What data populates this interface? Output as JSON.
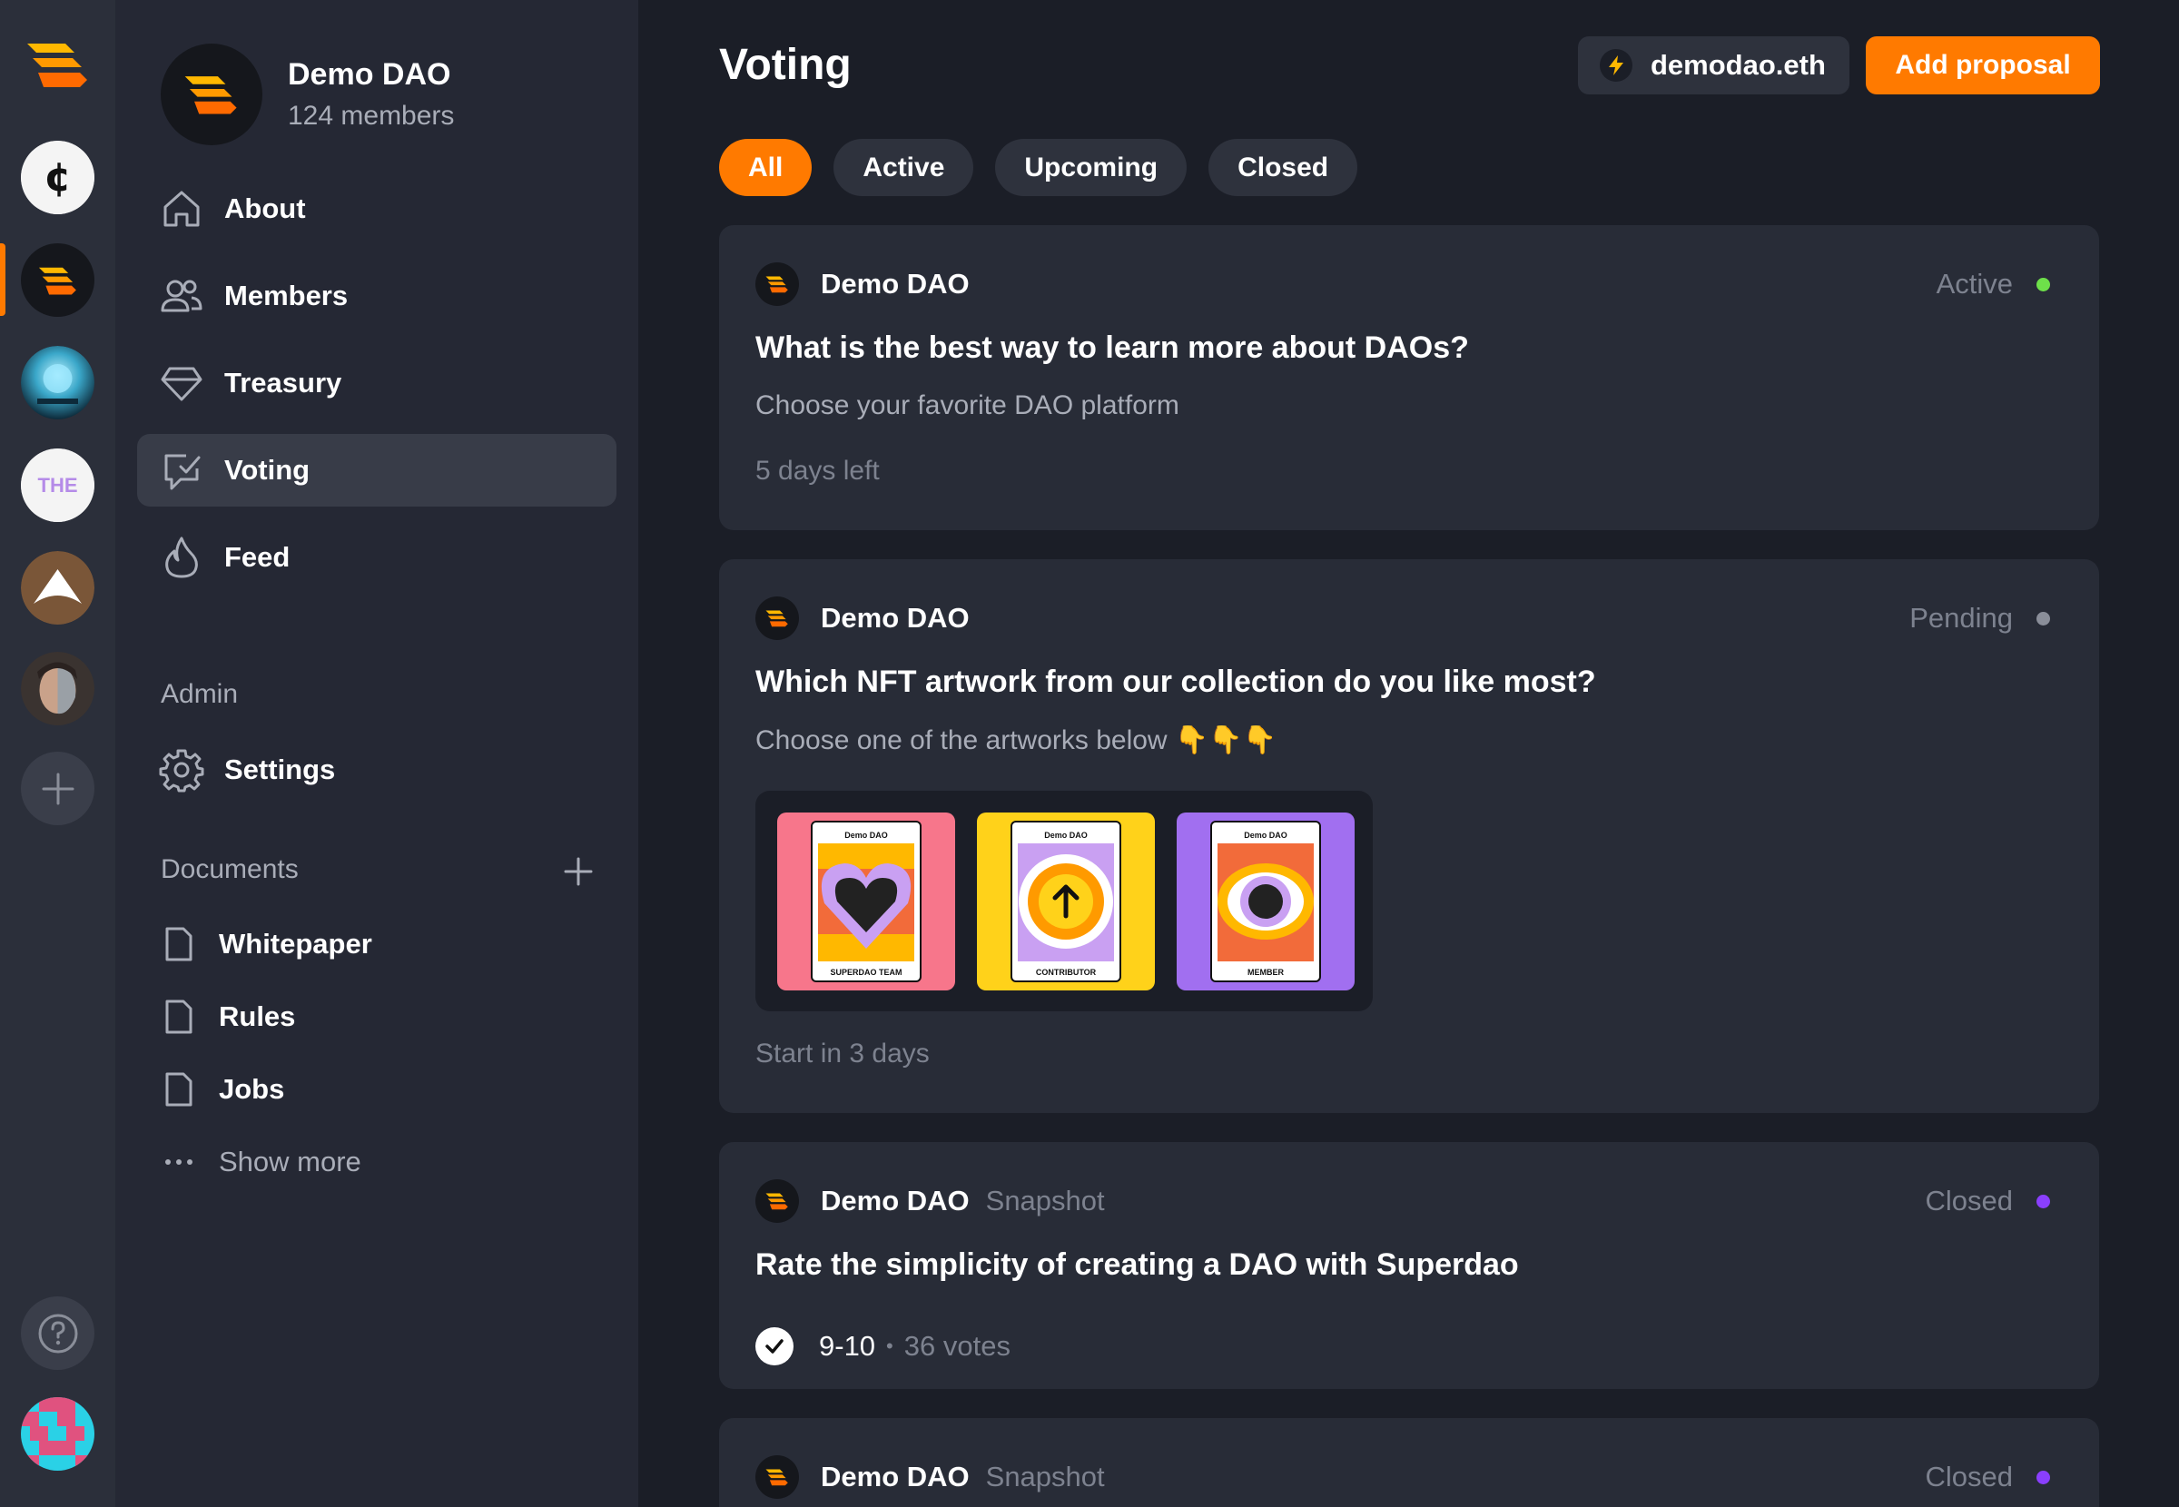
{
  "colors": {
    "accent": "#ff7a00",
    "active_dot": "#6ee04a",
    "pending_dot": "#8a8e99",
    "closed_dot": "#8a3ffc"
  },
  "rail": {
    "daos": [
      "coin-dao-icon",
      "superdao-icon",
      "space-dao-icon",
      "the-dao-icon",
      "arch-dao-icon",
      "portrait-dao-icon"
    ]
  },
  "sidebar": {
    "dao_name": "Demo DAO",
    "members": "124 members",
    "nav": [
      {
        "label": "About",
        "icon": "home-icon"
      },
      {
        "label": "Members",
        "icon": "users-icon"
      },
      {
        "label": "Treasury",
        "icon": "diamond-icon"
      },
      {
        "label": "Voting",
        "icon": "vote-icon"
      },
      {
        "label": "Feed",
        "icon": "flame-icon"
      }
    ],
    "admin_label": "Admin",
    "settings_label": "Settings",
    "documents_label": "Documents",
    "documents": [
      "Whitepaper",
      "Rules",
      "Jobs"
    ],
    "show_more": "Show more"
  },
  "header": {
    "title": "Voting",
    "ens": "demodao.eth",
    "add_proposal": "Add proposal"
  },
  "filters": [
    "All",
    "Active",
    "Upcoming",
    "Closed"
  ],
  "proposals": [
    {
      "org": "Demo DAO",
      "source": "",
      "status": "Active",
      "question": "What is the best way to learn more about DAOs?",
      "description": "Choose your favorite DAO platform",
      "meta": "5 days left"
    },
    {
      "org": "Demo DAO",
      "source": "",
      "status": "Pending",
      "question": "Which NFT artwork from our collection do you like most?",
      "description": "Choose one of the artworks below 👇👇👇",
      "meta": "Start in 3 days",
      "artworks": [
        {
          "header": "Demo DAO",
          "footer": "SUPERDAO TEAM"
        },
        {
          "header": "Demo DAO",
          "footer": "CONTRIBUTOR"
        },
        {
          "header": "Demo DAO",
          "footer": "MEMBER"
        }
      ]
    },
    {
      "org": "Demo DAO",
      "source": "Snapshot",
      "status": "Closed",
      "question": "Rate the simplicity of creating a DAO with Superdao",
      "result_option": "9-10",
      "result_sep": "•",
      "result_votes": "36 votes"
    },
    {
      "org": "Demo DAO",
      "source": "Snapshot",
      "status": "Closed"
    }
  ]
}
